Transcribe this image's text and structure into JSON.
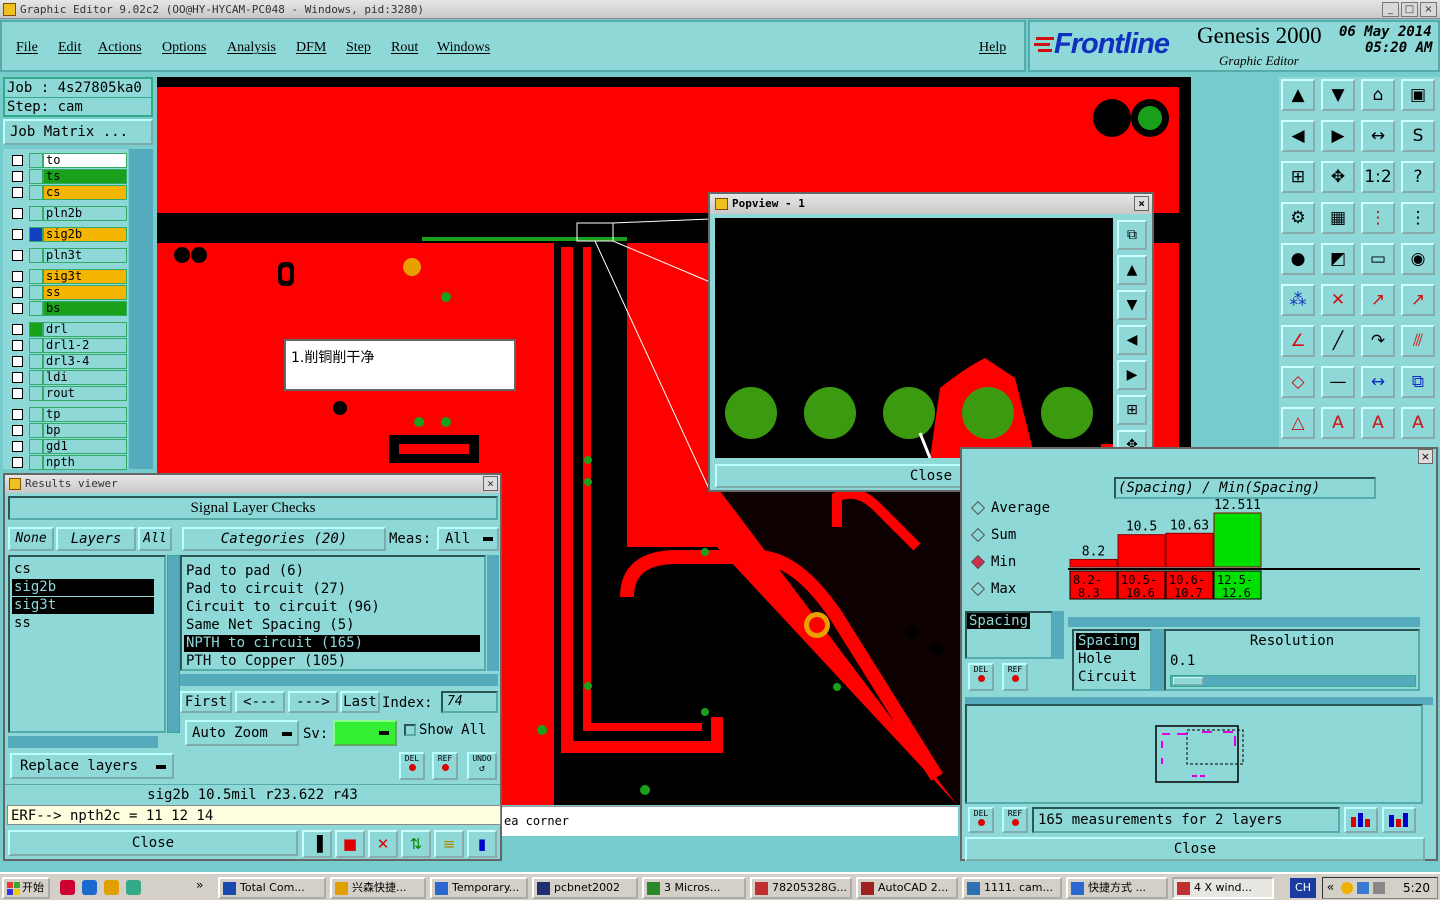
{
  "window": {
    "title": "Graphic Editor 9.02c2  (OO@HY-HYCAM-PC048 - Windows, pid:3280)"
  },
  "menu": [
    "File",
    "Edit",
    "Actions",
    "Options",
    "Analysis",
    "DFM",
    "Step",
    "Rout",
    "Windows"
  ],
  "help": "Help",
  "brand": {
    "logo": "Frontline",
    "product": "Genesis 2000",
    "subtitle": "Graphic Editor",
    "date": "06 May 2014",
    "time": "05:20 AM"
  },
  "job": {
    "job_label": "Job : 4s27805ka0",
    "step_label": "Step: cam",
    "matrix_button": "Job Matrix ..."
  },
  "layers": [
    {
      "name": "to",
      "color": "#ffffff",
      "group": 0
    },
    {
      "name": "ts",
      "color": "#1aa01a",
      "group": 0
    },
    {
      "name": "cs",
      "color": "#f5b400",
      "group": 0
    },
    {
      "name": "pln2b",
      "color": "#8fd8d8",
      "group": 1
    },
    {
      "name": "sig2b",
      "color": "#f5b400",
      "group": 2
    },
    {
      "name": "pln3t",
      "color": "#8fd8d8",
      "group": 3
    },
    {
      "name": "sig3t",
      "color": "#f5b400",
      "group": 4
    },
    {
      "name": "ss",
      "color": "#f5b400",
      "group": 4
    },
    {
      "name": "bs",
      "color": "#1aa01a",
      "group": 4
    },
    {
      "name": "drl",
      "color": "#8fd8d8",
      "group": 5
    },
    {
      "name": "drl1-2",
      "color": "#8fd8d8",
      "group": 5
    },
    {
      "name": "drl3-4",
      "color": "#8fd8d8",
      "group": 5
    },
    {
      "name": "ldi",
      "color": "#8fd8d8",
      "group": 5
    },
    {
      "name": "rout",
      "color": "#8fd8d8",
      "group": 5
    },
    {
      "name": "tp",
      "color": "#8fd8d8",
      "group": 6
    },
    {
      "name": "bp",
      "color": "#8fd8d8",
      "group": 6
    },
    {
      "name": "gd1",
      "color": "#8fd8d8",
      "group": 6
    },
    {
      "name": "npth",
      "color": "#8fd8d8",
      "group": 6
    }
  ],
  "canvas": {
    "note": "1.削铜削干净",
    "status_right": "ea corner"
  },
  "popview": {
    "title": "Popview - 1",
    "close": "Close"
  },
  "results": {
    "title": "Results viewer",
    "header": "Signal Layer Checks",
    "none_btn": "None",
    "layers_btn": "Layers",
    "all_btn": "All",
    "categories_btn": "Categories (20)",
    "meas_label": "Meas:",
    "meas_value": "All",
    "layer_list": [
      {
        "name": "cs",
        "selected": false
      },
      {
        "name": "sig2b",
        "selected": true
      },
      {
        "name": "sig3t",
        "selected": true
      },
      {
        "name": "ss",
        "selected": false
      }
    ],
    "categories": [
      {
        "name": "Pad to pad (6)",
        "selected": false
      },
      {
        "name": "Pad to circuit (27)",
        "selected": false
      },
      {
        "name": "Circuit to circuit (96)",
        "selected": false
      },
      {
        "name": "Same Net Spacing (5)",
        "selected": false
      },
      {
        "name": "NPTH to circuit (165)",
        "selected": true
      },
      {
        "name": "PTH to Copper (105)",
        "selected": false
      }
    ],
    "first": "First",
    "prev": "<---",
    "next": "--->",
    "last": "Last",
    "index_label": "Index:",
    "index_value": "74",
    "auto_zoom": "Auto Zoom",
    "sv_label": "Sv:",
    "show_all": "Show All",
    "replace_layers": "Replace layers",
    "status_line": "sig2b  10.5mil   r23.622   r43",
    "erf_line": "ERF--> npth2c = 11 12 14",
    "close": "Close",
    "del": "DEL",
    "ref": "REF",
    "undo": "UNDO"
  },
  "stats": {
    "header": "(Spacing) / Min(Spacing)",
    "options": [
      {
        "label": "Average",
        "selected": false
      },
      {
        "label": "Sum",
        "selected": false
      },
      {
        "label": "Min",
        "selected": true
      },
      {
        "label": "Max",
        "selected": false
      }
    ],
    "bars": [
      {
        "label": "8.2",
        "range": "8.2-8.3",
        "value": 8.2,
        "color": "#ff0000"
      },
      {
        "label": "10.5",
        "range": "10.5-10.6",
        "value": 10.5,
        "color": "#ff0000"
      },
      {
        "label": "10.63",
        "range": "10.6-10.7",
        "value": 10.63,
        "color": "#ff0000"
      },
      {
        "label": "12.511",
        "range": "12.5-12.6",
        "value": 12.511,
        "color": "#00e000"
      }
    ],
    "spacing_field": "Spacing",
    "list": [
      "Spacing",
      "Hole",
      "Circuit"
    ],
    "resolution_label": "Resolution",
    "resolution_value": "0.1",
    "measurements": "165 measurements for 2 layers",
    "close": "Close"
  },
  "taskbar": {
    "start": "开始",
    "tasks": [
      "Total Com...",
      "兴森快捷...",
      "Temporary...",
      "pcbnet2002",
      "3 Micros...",
      "78205328G...",
      "AutoCAD 2...",
      "1111. cam...",
      "快捷方式 ...",
      "4 X wind..."
    ],
    "lang": "CH",
    "clock": "5:20"
  }
}
